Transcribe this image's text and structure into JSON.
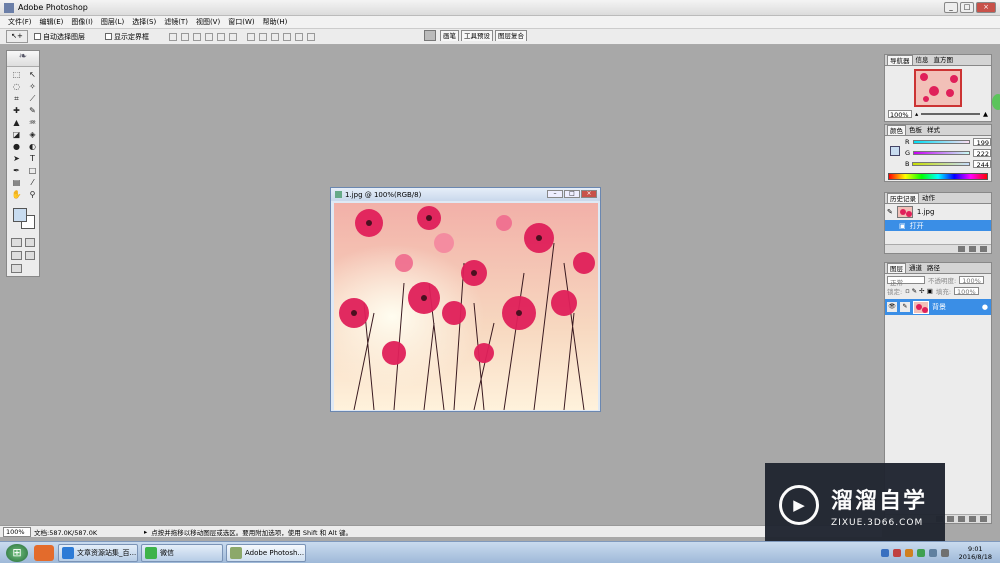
{
  "window": {
    "title": "Adobe Photoshop",
    "controls": [
      "_",
      "□",
      "×"
    ]
  },
  "menu": [
    "文件(F)",
    "编辑(E)",
    "图像(I)",
    "图层(L)",
    "选择(S)",
    "滤镜(T)",
    "视图(V)",
    "窗口(W)",
    "帮助(H)"
  ],
  "options": {
    "tool_icon": "move-tool-icon",
    "auto_select_label": "自动选择图层",
    "show_bounds_label": "显示定界框"
  },
  "palette_well": [
    "画笔",
    "工具预设",
    "图层复合"
  ],
  "toolbox": {
    "tools": [
      "marquee-icon",
      "move-icon",
      "lasso-icon",
      "magic-wand-icon",
      "crop-icon",
      "slice-icon",
      "healing-icon",
      "brush-icon",
      "stamp-icon",
      "history-brush-icon",
      "eraser-icon",
      "bucket-icon",
      "blur-icon",
      "dodge-icon",
      "path-select-icon",
      "type-icon",
      "pen-icon",
      "shape-icon",
      "notes-icon",
      "eyedropper-icon",
      "hand-icon",
      "zoom-icon"
    ],
    "foreground_color": "#c8dcf0",
    "background_color": "#ffffff"
  },
  "document": {
    "title": "1.jpg @ 100%(RGB/8)"
  },
  "status": {
    "zoom": "100%",
    "doc": "文档:587.0K/587.0K",
    "hint": "点按并拖移以移动图层或选区。要用附加选项，使用 Shift 和 Alt 键。"
  },
  "navigator": {
    "tabs": [
      "导航器",
      "信息",
      "直方图"
    ],
    "zoom": "100%"
  },
  "color_panel": {
    "tabs": [
      "颜色",
      "色板",
      "样式"
    ],
    "channels": [
      {
        "label": "R",
        "value": "199"
      },
      {
        "label": "G",
        "value": "222"
      },
      {
        "label": "B",
        "value": "244"
      }
    ]
  },
  "history_panel": {
    "tabs": [
      "历史记录",
      "动作"
    ],
    "snapshot": "1.jpg",
    "step": "打开"
  },
  "layers_panel": {
    "tabs": [
      "图层",
      "通道",
      "路径"
    ],
    "blend_mode": "正常",
    "opacity_label": "不透明度:",
    "opacity_value": "100%",
    "lock_label": "锁定:",
    "fill_label": "填充:",
    "fill_value": "100%",
    "layer_name": "背景"
  },
  "taskbar": {
    "tasks": [
      "文章资源站集_百...",
      "微信",
      "Adobe Photosh..."
    ],
    "time": "9:01",
    "date": "2016/8/18"
  },
  "watermark": {
    "cn": "溜溜自学",
    "en": "ZIXUE.3D66.COM"
  }
}
